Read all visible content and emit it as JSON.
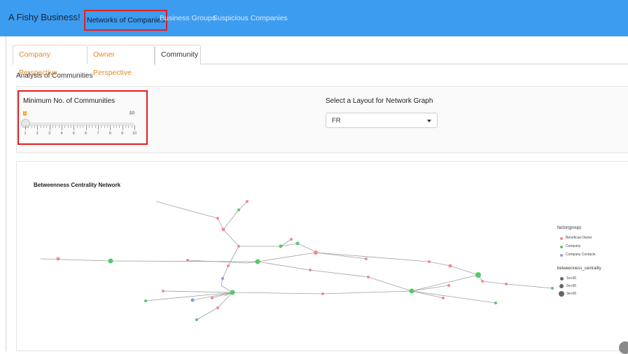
{
  "navbar": {
    "brand": "A Fishy Business!",
    "links": [
      "Networks of Companies",
      "Business Groups",
      "Suspicious Companies"
    ],
    "active_link": "Networks of Companies"
  },
  "tabs": [
    {
      "label": "Company Perspective",
      "active": false
    },
    {
      "label": "Owner Perspective",
      "active": false
    },
    {
      "label": "Community",
      "active": true
    }
  ],
  "section_title": "Analysis of Communities",
  "slider": {
    "label": "Minimum No. of Communities",
    "min": 1,
    "max": 10,
    "value": 1,
    "min_label": "1",
    "max_label": "10",
    "tick_labels": [
      "1",
      "2",
      "3",
      "4",
      "5",
      "6",
      "7",
      "8",
      "9",
      "10"
    ]
  },
  "layout_select": {
    "label": "Select a Layout for Network Graph",
    "value": "FR"
  },
  "graph": {
    "title": "Betweenness  Centrality  Network",
    "legend": {
      "group_title": "factor(group)",
      "groups": [
        {
          "label": "Beneficial Owner",
          "color": "#f08c8c"
        },
        {
          "label": "Company",
          "color": "#55c86a"
        },
        {
          "label": "Company Contacts",
          "color": "#7e9ee6"
        }
      ],
      "size_title": "betweenness_centrality",
      "sizes": [
        "1e+06",
        "2e+06",
        "3e+06"
      ]
    }
  },
  "colors": {
    "navbar": "#3c9cf0",
    "highlight_box": "#e41e1e",
    "tab_text": "#e08a2a",
    "beneficial_owner": "#f08c8c",
    "company": "#55c86a",
    "company_contacts": "#7e9ee6",
    "edge": "#a0a0a0"
  },
  "icons": {
    "select_caret": "caret-down-icon",
    "fullscreen": "fullscreen-icon"
  }
}
